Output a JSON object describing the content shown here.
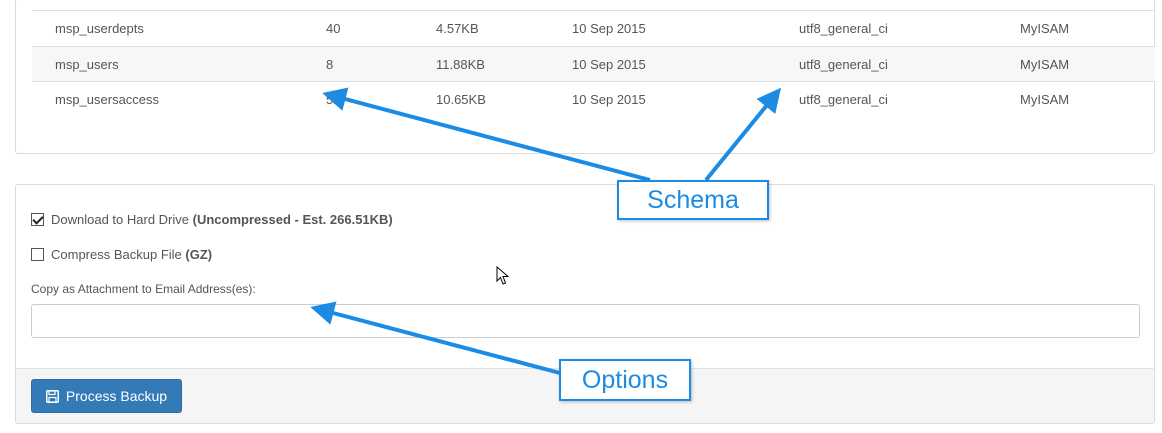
{
  "table": {
    "rows": [
      {
        "name": "msp_userdepts",
        "rows": "40",
        "size": "4.57KB",
        "date": "10 Sep 2015",
        "collation": "utf8_general_ci",
        "engine": "MyISAM"
      },
      {
        "name": "msp_users",
        "rows": "8",
        "size": "11.88KB",
        "date": "10 Sep 2015",
        "collation": "utf8_general_ci",
        "engine": "MyISAM"
      },
      {
        "name": "msp_usersaccess",
        "rows": "52",
        "size": "10.65KB",
        "date": "10 Sep 2015",
        "collation": "utf8_general_ci",
        "engine": "MyISAM"
      }
    ]
  },
  "options": {
    "download": {
      "label": "Download to Hard Drive",
      "detail": "(Uncompressed - Est. 266.51KB)",
      "checked": true
    },
    "compress": {
      "label": "Compress Backup File",
      "detail": "(GZ)",
      "checked": false
    },
    "email_label": "Copy as Attachment to Email Address(es):",
    "email_value": "",
    "email_placeholder": ""
  },
  "footer": {
    "process_button": "Process Backup",
    "process_icon": "save-icon"
  },
  "callouts": {
    "schema": "Schema",
    "options": "Options"
  },
  "colors": {
    "accent": "#1c8be3",
    "button": "#337ab7"
  }
}
